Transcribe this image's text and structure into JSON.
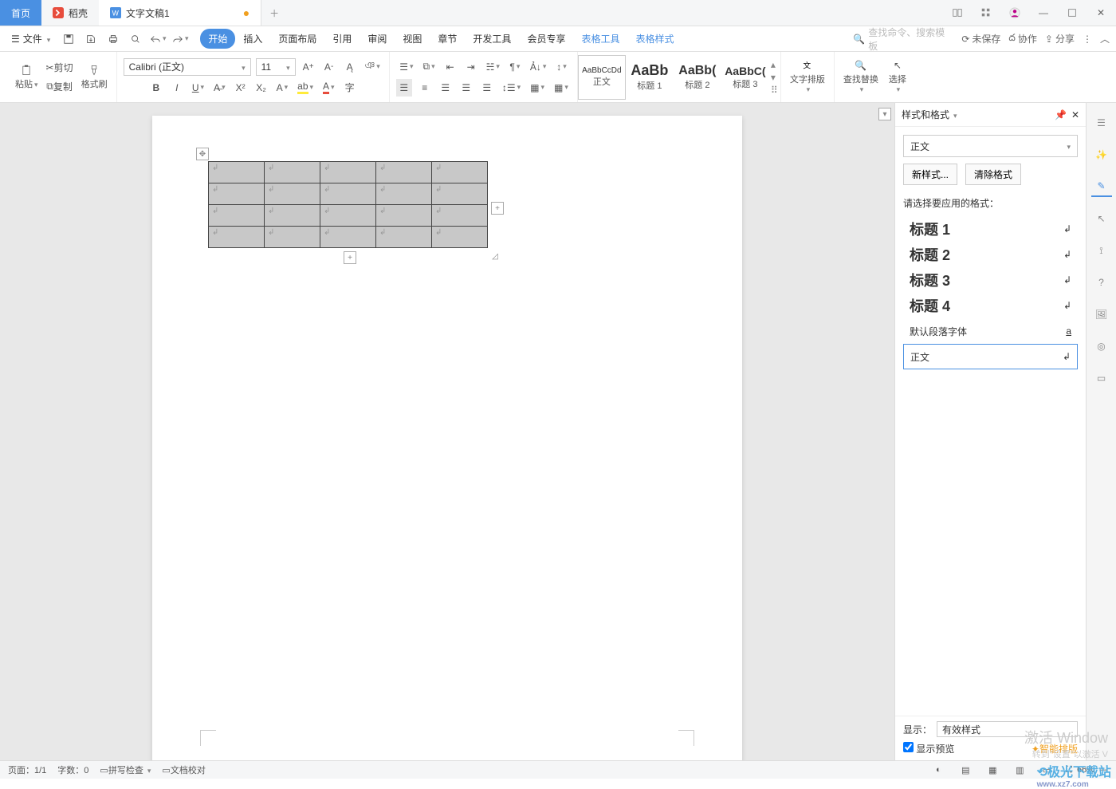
{
  "tabs": {
    "home": "首页",
    "shell": "稻壳",
    "doc": "文字文稿1"
  },
  "file_menu": "文件",
  "menus": {
    "start": "开始",
    "insert": "插入",
    "layout": "页面布局",
    "ref": "引用",
    "review": "审阅",
    "view": "视图",
    "chapter": "章节",
    "dev": "开发工具",
    "member": "会员专享",
    "tabletool": "表格工具",
    "tablestyle": "表格样式"
  },
  "search_placeholder": "查找命令、搜索模板",
  "links": {
    "unsaved": "未保存",
    "collab": "协作",
    "share": "分享"
  },
  "clipboard": {
    "cut": "剪切",
    "copy": "复制",
    "paste": "粘贴",
    "brush": "格式刷"
  },
  "font": {
    "name": "Calibri (正文)",
    "size": "11"
  },
  "styles": {
    "s1": {
      "prev": "AaBbCcDd",
      "lbl": "正文"
    },
    "s2": {
      "prev": "AaBb",
      "lbl": "标题 1"
    },
    "s3": {
      "prev": "AaBb(",
      "lbl": "标题 2"
    },
    "s4": {
      "prev": "AaBbC(",
      "lbl": "标题 3"
    }
  },
  "ribbon_right": {
    "typeset": "文字排版",
    "findreplace": "查找替换",
    "select": "选择"
  },
  "panel": {
    "title": "样式和格式",
    "drop": "正文",
    "newstyle": "新样式...",
    "clear": "清除格式",
    "prompt": "请选择要应用的格式：",
    "list": [
      {
        "name": "标题 1",
        "mark": "↲"
      },
      {
        "name": "标题 2",
        "mark": "↲"
      },
      {
        "name": "标题 3",
        "mark": "↲"
      },
      {
        "name": "标题 4",
        "mark": "↲"
      }
    ],
    "default_font": "默认段落字体",
    "default_mark": "a",
    "current": "正文",
    "current_mark": "↲",
    "show": "显示：",
    "show_val": "有效样式",
    "preview": "显示预览",
    "smart": "智能排版"
  },
  "status": {
    "page": "页面：1/1",
    "words": "字数：0",
    "spell": "拼写检查",
    "proof": "文档校对",
    "zoom": "66%"
  },
  "watermark": {
    "l1": "激活 Window",
    "l2": "转到\"设置\"以激活 V"
  },
  "logo": {
    "l1": "极光下载站",
    "l2": "www.xz7.com"
  }
}
